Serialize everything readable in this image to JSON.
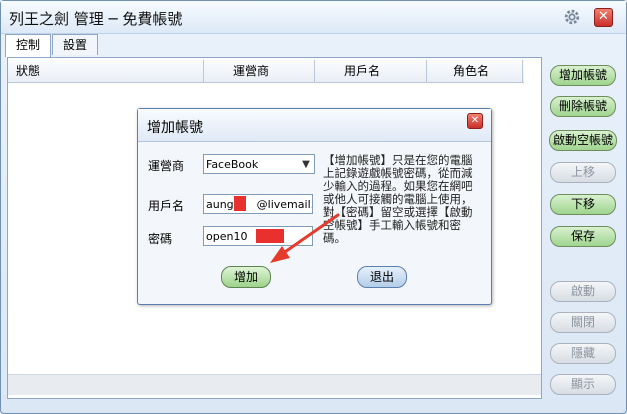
{
  "window": {
    "title": "列王之劍 管理 ─ 免費帳號"
  },
  "tabs": [
    {
      "label": "控制"
    },
    {
      "label": "設置"
    }
  ],
  "table": {
    "headers": [
      "狀態",
      "運營商",
      "用戶名",
      "角色名"
    ],
    "rows": []
  },
  "side_buttons": [
    {
      "label": "增加帳號",
      "enabled": true
    },
    {
      "label": "刪除帳號",
      "enabled": true
    },
    {
      "label": "啟動空帳號",
      "enabled": true
    },
    {
      "label": "上移",
      "enabled": false
    },
    {
      "label": "下移",
      "enabled": true
    },
    {
      "label": "保存",
      "enabled": true
    },
    {
      "label": "啟動",
      "enabled": false
    },
    {
      "label": "關閉",
      "enabled": false
    },
    {
      "label": "隱藏",
      "enabled": false
    },
    {
      "label": "顯示",
      "enabled": false
    }
  ],
  "dialog": {
    "title": "增加帳號",
    "operator_label": "運營商",
    "operator_value": "FaceBook",
    "username_label": "用戶名",
    "username_value_prefix": "aung0",
    "username_value_suffix": "@livemail.tw",
    "password_label": "密碼",
    "password_value_prefix": "open10",
    "help_text": "【增加帳號】只是在您的電腦上記錄遊戲帳號密碼，從而減少輸入的過程。如果您在網吧或他人可接觸的電腦上使用，對【密碼】留空或選擇【啟動空帳號】手工輸入帳號和密碼。",
    "add_button": "增加",
    "exit_button": "退出"
  },
  "colors": {
    "accent_green": "#9fd48f",
    "redaction": "#e8312e",
    "annotation_arrow": "#e53b2c"
  }
}
